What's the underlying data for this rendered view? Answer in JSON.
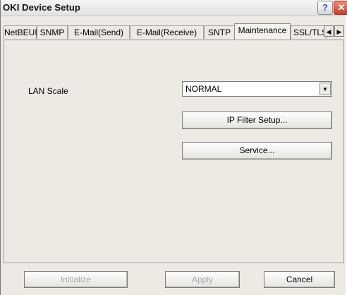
{
  "window": {
    "title": "OKI Device Setup",
    "help_label": "?",
    "close_label": "✕"
  },
  "tabs": [
    {
      "label": "NetBEUI"
    },
    {
      "label": "SNMP"
    },
    {
      "label": "E-Mail(Send)"
    },
    {
      "label": "E-Mail(Receive)"
    },
    {
      "label": "SNTP"
    },
    {
      "label": "Maintenance",
      "active": true
    },
    {
      "label": "SSL/TLS"
    }
  ],
  "tab_scroll": {
    "left_icon": "◀",
    "right_icon": "▶"
  },
  "maintenance": {
    "lan_scale_label": "LAN Scale",
    "lan_scale_value": "NORMAL",
    "dropdown_icon": "▼",
    "ip_filter_button": "IP Filter Setup...",
    "service_button": "Service..."
  },
  "footer": {
    "initialize_label": "Initialize",
    "apply_label": "Apply",
    "cancel_label": "Cancel"
  }
}
